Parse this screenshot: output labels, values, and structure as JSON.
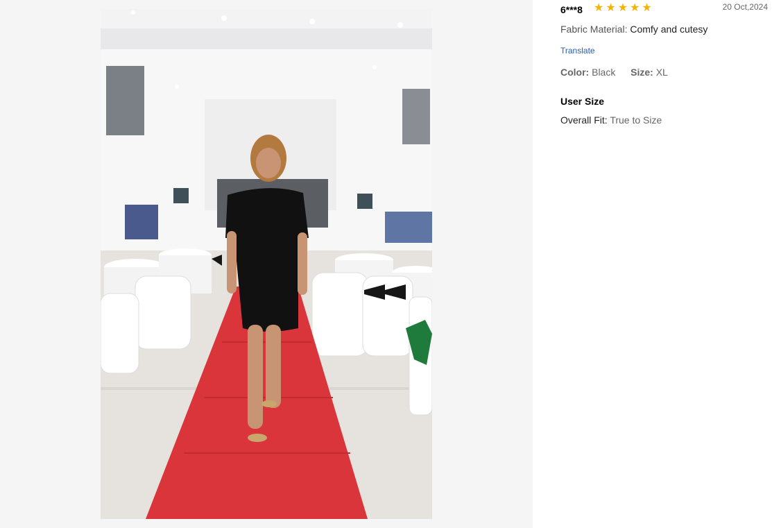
{
  "review": {
    "reviewer": "6***8",
    "rating": 5,
    "stars": [
      "★",
      "★",
      "★",
      "★",
      "★"
    ],
    "date": "20 Oct,2024",
    "fabric_label": "Fabric Material:",
    "fabric_value": "Comfy and cutesy",
    "translate_label": "Translate",
    "color_label": "Color:",
    "color_value": "Black",
    "size_label": "Size:",
    "size_value": "XL",
    "user_size_heading": "User Size",
    "fit_label": "Overall Fit:",
    "fit_value": "True to Size"
  },
  "colors": {
    "star": "#f5b301",
    "link": "#2a5ea9",
    "panel_bg": "#f5f5f5",
    "carpet": "#d9353a",
    "dress": "#111111"
  },
  "icons": {
    "rating": "star-icon"
  }
}
